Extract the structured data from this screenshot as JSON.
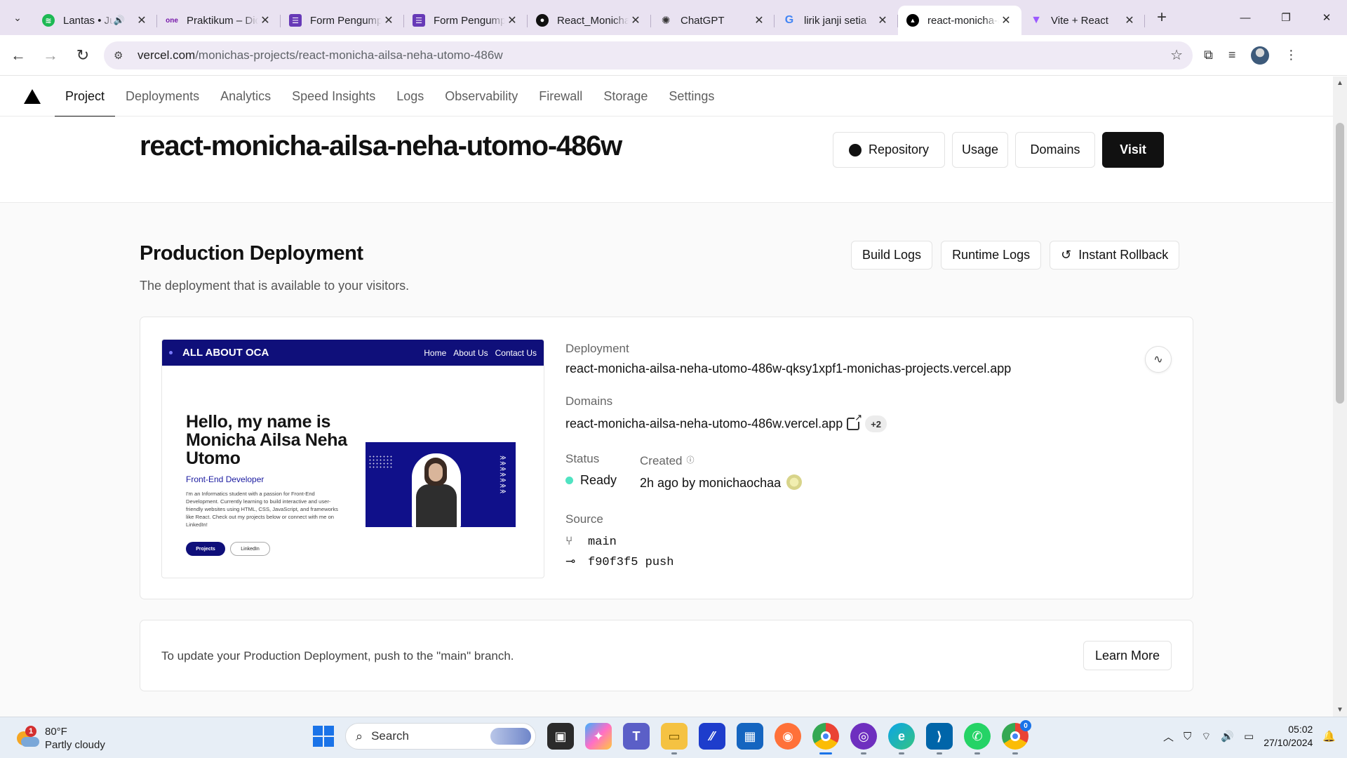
{
  "browser": {
    "tabs": [
      {
        "title": "Lantas • Juicy Luicy",
        "favicon": "spotify-icon",
        "color": "#1db954",
        "audio": true
      },
      {
        "title": "Praktikum – Dicoding",
        "favicon": "onenote-icon",
        "color": "#7719aa"
      },
      {
        "title": "Form Pengumpulan Tugas",
        "favicon": "forms-icon",
        "color": "#673ab7"
      },
      {
        "title": "Form Pengumpulan Tugas",
        "favicon": "forms-icon",
        "color": "#673ab7"
      },
      {
        "title": "React_Monicha",
        "favicon": "github-icon",
        "color": "#111111"
      },
      {
        "title": "ChatGPT",
        "favicon": "chatgpt-icon",
        "color": "#444444"
      },
      {
        "title": "lirik janji setia",
        "favicon": "google-icon",
        "color": "#4285f4"
      },
      {
        "title": "react-monicha-ailsa",
        "favicon": "vercel-icon",
        "color": "#000000",
        "active": true
      },
      {
        "title": "Vite + React",
        "favicon": "vite-icon",
        "color": "#9b59ff"
      }
    ],
    "url_host": "vercel.com",
    "url_path": "/monichas-projects/react-monicha-ailsa-neha-utomo-486w"
  },
  "vercel": {
    "nav": [
      "Project",
      "Deployments",
      "Analytics",
      "Speed Insights",
      "Logs",
      "Observability",
      "Firewall",
      "Storage",
      "Settings"
    ],
    "project_title": "react-monicha-ailsa-neha-utomo-486w",
    "buttons": {
      "repository": "Repository",
      "usage": "Usage",
      "domains": "Domains",
      "visit": "Visit"
    },
    "production": {
      "title": "Production Deployment",
      "subtitle": "The deployment that is available to your visitors.",
      "build_logs": "Build Logs",
      "runtime_logs": "Runtime Logs",
      "rollback": "Instant Rollback",
      "deployment_label": "Deployment",
      "deployment_url": "react-monicha-ailsa-neha-utomo-486w-qksy1xpf1-monichas-projects.vercel.app",
      "domains_label": "Domains",
      "domain": "react-monicha-ailsa-neha-utomo-486w.vercel.app",
      "domain_extra": "+2",
      "status_label": "Status",
      "status": "Ready",
      "created_label": "Created",
      "created": "2h ago by monichaochaa",
      "source_label": "Source",
      "branch": "main",
      "commit": "f90f3f5 push"
    },
    "preview": {
      "brand": "ALL ABOUT OCA",
      "links": [
        "Home",
        "About Us",
        "Contact Us"
      ],
      "heading": "Hello, my name is Monicha Ailsa Neha Utomo",
      "role": "Front-End Developer",
      "description": "I'm an Informatics student with a passion for Front-End Development. Currently learning to build interactive and user-friendly websites using HTML, CSS, JavaScript, and frameworks like React. Check out my projects below or connect with me on LinkedIn!",
      "btn_projects": "Projects",
      "btn_linkedin": "LinkedIn"
    },
    "update": {
      "text": "To update your Production Deployment, push to the \"main\" branch.",
      "learn_more": "Learn More"
    }
  },
  "taskbar": {
    "temperature": "80°F",
    "condition": "Partly cloudy",
    "weather_badge": "1",
    "search": "Search",
    "time": "05:02",
    "date": "27/10/2024",
    "chrome_badge": "0"
  }
}
